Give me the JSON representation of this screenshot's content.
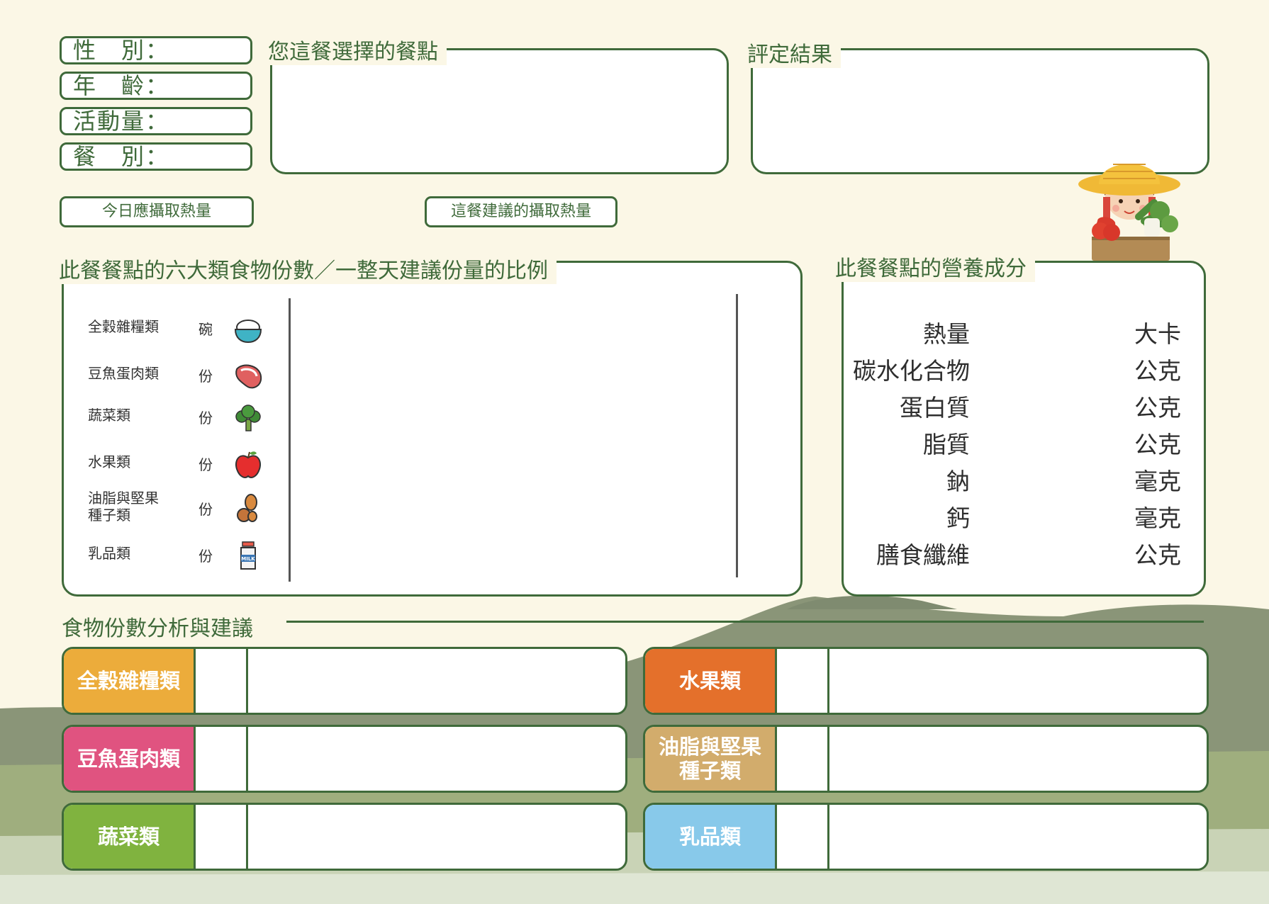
{
  "profile": {
    "gender_label": "性　別：",
    "age_label": "年　齡：",
    "activity_label": "活動量：",
    "meal_label": "餐　別："
  },
  "buttons": {
    "daily_kcal": "今日應攝取熱量",
    "meal_kcal": "這餐建議的攝取熱量"
  },
  "sections": {
    "meal_choice": "您這餐選擇的餐點",
    "result": "評定結果",
    "six_food": "此餐餐點的六大類食物份數／一整天建議份量的比例",
    "nutrition": "此餐餐點的營養成分",
    "analysis": "食物份數分析與建議"
  },
  "food_groups": [
    {
      "name": "全穀雜糧類",
      "unit": "碗",
      "icon": "rice-bowl-icon"
    },
    {
      "name": "豆魚蛋肉類",
      "unit": "份",
      "icon": "steak-icon"
    },
    {
      "name": "蔬菜類",
      "unit": "份",
      "icon": "broccoli-icon"
    },
    {
      "name": "水果類",
      "unit": "份",
      "icon": "apple-icon"
    },
    {
      "name": "油脂與堅果種子類",
      "name_line1": "油脂與堅果",
      "name_line2": "種子類",
      "unit": "份",
      "icon": "peanut-icon"
    },
    {
      "name": "乳品類",
      "unit": "份",
      "icon": "milk-bottle-icon"
    }
  ],
  "milk_text": "MILK",
  "nutrients": [
    {
      "name": "熱量",
      "unit": "大卡"
    },
    {
      "name": "碳水化合物",
      "unit": "公克"
    },
    {
      "name": "蛋白質",
      "unit": "公克"
    },
    {
      "name": "脂質",
      "unit": "公克"
    },
    {
      "name": "鈉",
      "unit": "毫克"
    },
    {
      "name": "鈣",
      "unit": "毫克"
    },
    {
      "name": "膳食纖維",
      "unit": "公克"
    }
  ],
  "analysis": [
    {
      "label": "全穀雜糧類",
      "color": "#ecac3b"
    },
    {
      "label": "豆魚蛋肉類",
      "color": "#e05380"
    },
    {
      "label": "蔬菜類",
      "color": "#80b33f"
    },
    {
      "label": "水果類",
      "color": "#e4702b"
    },
    {
      "label_line1": "油脂與堅果",
      "label_line2": "種子類",
      "color": "#d2ac6c"
    },
    {
      "label": "乳品類",
      "color": "#88c9ea"
    }
  ],
  "colors": {
    "border": "#3f6a3a",
    "background": "#fbf7e6"
  }
}
